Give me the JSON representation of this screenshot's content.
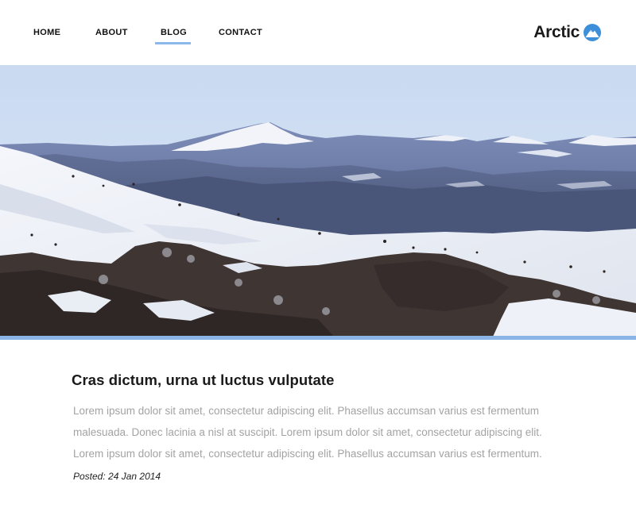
{
  "nav": {
    "items": [
      {
        "label": "HOME"
      },
      {
        "label": "ABOUT"
      },
      {
        "label": "BLOG",
        "active": true
      },
      {
        "label": "CONTACT"
      }
    ]
  },
  "logo": {
    "text": "Arctic",
    "icon": "mountain-badge-icon"
  },
  "hero": {
    "subject": "snowy mountain range landscape photo"
  },
  "article": {
    "title": "Cras dictum, urna ut luctus vulputate",
    "body_lines": [
      "Lorem ipsum dolor sit amet, consectetur adipiscing elit. Phasellus accumsan varius est fermentum",
      "malesuada. Donec lacinia a nisl at suscipit. Lorem ipsum dolor sit amet, consectetur adipiscing elit.",
      "Lorem ipsum dolor sit amet, consectetur adipiscing elit. Phasellus accumsan varius est fermentum."
    ],
    "posted": "Posted: 24 Jan 2014"
  },
  "colors": {
    "accent": "#8bb8ea",
    "text_dark": "#1a1a1a",
    "body_text": "#a3a3a3"
  }
}
